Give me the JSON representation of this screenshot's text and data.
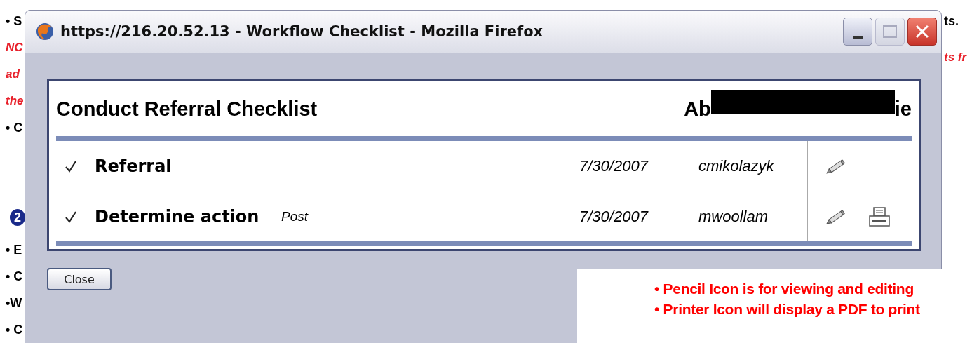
{
  "document": {
    "left_fragments": [
      {
        "kind": "bullet",
        "text": "• S"
      },
      {
        "kind": "note",
        "text": "NC"
      },
      {
        "kind": "note",
        "text": "ad"
      },
      {
        "kind": "note",
        "text": "the"
      },
      {
        "kind": "bullet",
        "text": "• C"
      },
      {
        "kind": "step",
        "text": "2"
      },
      {
        "kind": "bullet",
        "text": "• E"
      },
      {
        "kind": "bullet",
        "text": "• C"
      },
      {
        "kind": "bullet",
        "text": "•W"
      },
      {
        "kind": "bullet",
        "text": "• C"
      }
    ],
    "right_fragments": [
      {
        "kind": "bullet",
        "text": "ts."
      },
      {
        "kind": "note",
        "text": "ts fr"
      }
    ]
  },
  "window": {
    "title": "https://216.20.52.13 - Workflow Checklist - Mozilla Firefox",
    "heading": "Conduct Referral Checklist",
    "name_start": "Ab",
    "name_end": "ie",
    "rows": [
      {
        "done": true,
        "task": "Referral",
        "date": "7/30/2007",
        "user": "cmikolazyk",
        "printable": false
      },
      {
        "done": true,
        "task": "Determine action",
        "note": "Post",
        "date": "7/30/2007",
        "user": "mwoollam",
        "printable": true
      }
    ],
    "close_button": "Close"
  },
  "callout": {
    "lines": [
      "• Pencil Icon is for viewing and editing",
      "• Printer Icon will display a PDF to print"
    ]
  }
}
